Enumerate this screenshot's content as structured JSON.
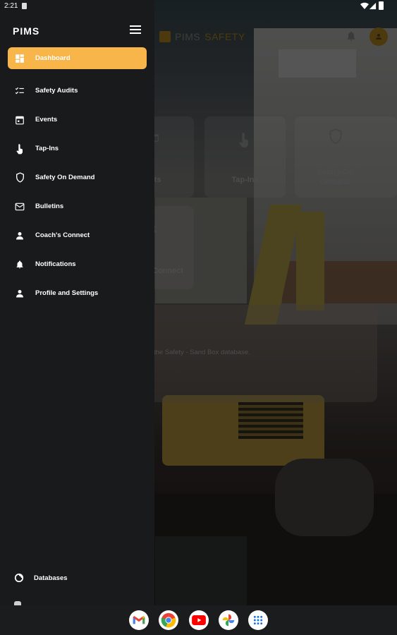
{
  "status_bar": {
    "time": "2:21"
  },
  "drawer": {
    "brand": "PIMS",
    "items": [
      {
        "label": "Dashboard",
        "icon": "dashboard-icon",
        "active": true
      },
      {
        "label": "Safety Audits",
        "icon": "checklist-icon"
      },
      {
        "label": "Events",
        "icon": "calendar-icon"
      },
      {
        "label": "Tap-Ins",
        "icon": "tap-icon"
      },
      {
        "label": "Safety On Demand",
        "icon": "shield-icon"
      },
      {
        "label": "Bulletins",
        "icon": "mail-icon"
      },
      {
        "label": "Coach's Connect",
        "icon": "person-icon"
      },
      {
        "label": "Notifications",
        "icon": "bell-icon"
      },
      {
        "label": "Profile and Settings",
        "icon": "person-icon"
      }
    ],
    "bottom_item": {
      "label": "Databases",
      "icon": "database-icon"
    }
  },
  "header": {
    "logo_left": "PIMS",
    "logo_right": "SAFETY"
  },
  "tiles": {
    "events": "nts",
    "tapins": "Tap-Ins",
    "safety_line1": "Safety On",
    "safety_line2": "Demand",
    "coach": "Connect"
  },
  "info_card": {
    "message": "e in the Safety - Sand Box database."
  },
  "dock": {
    "apps": [
      "Gmail",
      "Chrome",
      "YouTube",
      "Photos",
      "App drawer"
    ]
  },
  "colors": {
    "accent": "#f7b54a",
    "drawer_bg": "#191a1c",
    "brand_gold": "#8a6a1a"
  }
}
